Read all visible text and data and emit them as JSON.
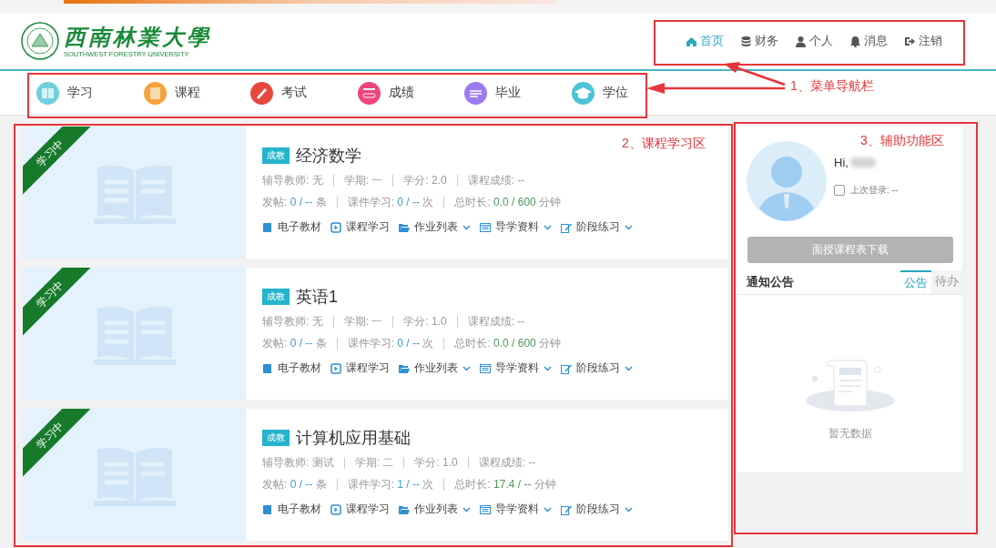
{
  "header": {
    "logo_title": "西南林業大學",
    "logo_subtitle": "SOUTHWEST FORESTRY UNIVERSITY"
  },
  "top_nav": [
    {
      "label": "首页",
      "selected": true
    },
    {
      "label": "财务",
      "selected": false
    },
    {
      "label": "个人",
      "selected": false
    },
    {
      "label": "消息",
      "selected": false
    },
    {
      "label": "注销",
      "selected": false
    }
  ],
  "sub_nav": [
    {
      "label": "学习",
      "color": "#6fd0dc"
    },
    {
      "label": "课程",
      "color": "#f7a23a"
    },
    {
      "label": "考试",
      "color": "#e8473c"
    },
    {
      "label": "成绩",
      "color": "#f0447f"
    },
    {
      "label": "毕业",
      "color": "#9b7cf0"
    },
    {
      "label": "学位",
      "color": "#4cc3d6"
    }
  ],
  "courses": [
    {
      "badge": "学习中",
      "tag": "成教",
      "title": "经济数学",
      "meta": [
        "辅导教师: 无",
        "学期: 一",
        "学分: 2.0",
        "课程成绩: --"
      ],
      "stats": [
        {
          "label": "发帖:",
          "value": "0 / --",
          "unit": "条",
          "color": "#3a9ad9"
        },
        {
          "label": "课件学习:",
          "value": "0 / --",
          "unit": "次",
          "color": "#3a9ad9"
        },
        {
          "label": "总时长:",
          "value": "0.0 / 600",
          "unit": "分钟",
          "color": "#4a9a5a"
        }
      ],
      "actions": [
        {
          "label": "电子教材",
          "dropdown": false
        },
        {
          "label": "课程学习",
          "dropdown": false
        },
        {
          "label": "作业列表",
          "dropdown": true
        },
        {
          "label": "导学资料",
          "dropdown": true
        },
        {
          "label": "阶段练习",
          "dropdown": true
        }
      ]
    },
    {
      "badge": "学习中",
      "tag": "成教",
      "title": "英语1",
      "meta": [
        "辅导教师: 无",
        "学期: 一",
        "学分: 1.0",
        "课程成绩: --"
      ],
      "stats": [
        {
          "label": "发帖:",
          "value": "0 / --",
          "unit": "条",
          "color": "#3a9ad9"
        },
        {
          "label": "课件学习:",
          "value": "0 / --",
          "unit": "次",
          "color": "#3a9ad9"
        },
        {
          "label": "总时长:",
          "value": "0.0 / 600",
          "unit": "分钟",
          "color": "#4a9a5a"
        }
      ],
      "actions": [
        {
          "label": "电子教材",
          "dropdown": false
        },
        {
          "label": "课程学习",
          "dropdown": false
        },
        {
          "label": "作业列表",
          "dropdown": true
        },
        {
          "label": "导学资料",
          "dropdown": true
        },
        {
          "label": "阶段练习",
          "dropdown": true
        }
      ]
    },
    {
      "badge": "学习中",
      "tag": "成教",
      "title": "计算机应用基础",
      "meta": [
        "辅导教师: 测试",
        "学期: 二",
        "学分: 1.0",
        "课程成绩: --"
      ],
      "stats": [
        {
          "label": "发帖:",
          "value": "0 / --",
          "unit": "条",
          "color": "#3a9ad9"
        },
        {
          "label": "课件学习:",
          "value": "1 / --",
          "unit": "次",
          "color": "#3a9ad9"
        },
        {
          "label": "总时长:",
          "value": "17.4 / --",
          "unit": "分钟",
          "color": "#4a9a5a"
        }
      ],
      "actions": [
        {
          "label": "电子教材",
          "dropdown": false
        },
        {
          "label": "课程学习",
          "dropdown": false
        },
        {
          "label": "作业列表",
          "dropdown": true
        },
        {
          "label": "导学资料",
          "dropdown": true
        },
        {
          "label": "阶段练习",
          "dropdown": true
        }
      ]
    }
  ],
  "sidebar": {
    "greeting": "Hi,",
    "last_login": {
      "label": "上次登录: --",
      "checked": false
    },
    "download_button": {
      "label": "面授课程表下载",
      "disabled": true
    },
    "notices": {
      "title": "通知公告",
      "tabs": [
        {
          "label": "公告",
          "selected": true
        },
        {
          "label": "待办",
          "selected": false
        }
      ],
      "empty_text": "暂无数据"
    }
  },
  "annotations": [
    {
      "label": "1、菜单导航栏"
    },
    {
      "label": "2、课程学习区"
    },
    {
      "label": "3、辅助功能区"
    }
  ]
}
